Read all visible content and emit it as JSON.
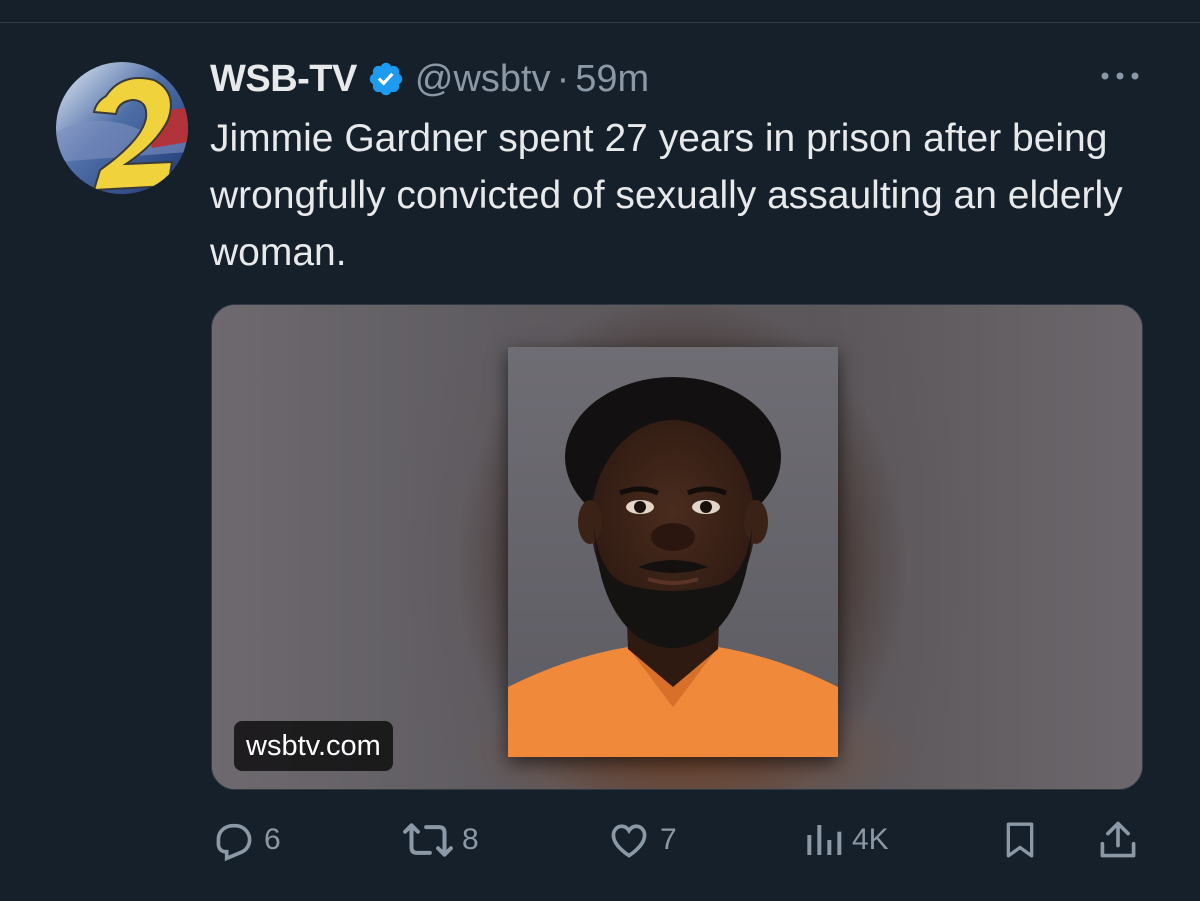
{
  "tweet": {
    "display_name": "WSB-TV",
    "handle": "@wsbtv",
    "separator": "·",
    "time": "59m",
    "text": "Jimmie Gardner spent 27 years in prison after being wrongfully convicted of sexually assaulting an elderly woman.",
    "avatar_icon": "wsb-channel-2-logo",
    "verified_icon": "verified-badge-icon",
    "accent_color": "#1d9bf0"
  },
  "media": {
    "source_label": "wsbtv.com",
    "alt": "Mugshot of a man in an orange jumpsuit"
  },
  "actions": {
    "reply_count": "6",
    "retweet_count": "8",
    "like_count": "7",
    "views_count": "4K"
  }
}
